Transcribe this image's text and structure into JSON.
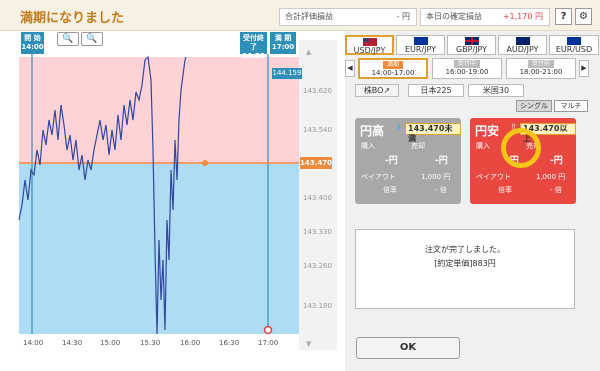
{
  "header": {
    "title": "満期になりました",
    "total_eval_label": "合計評価損益",
    "total_eval_value": "- 円",
    "today_pl_label": "本日の確定損益",
    "today_pl_value": "+1,170 円",
    "help_label": "?",
    "settings_icon": "gear-icon"
  },
  "chart": {
    "start_label_top": "開 始",
    "start_label_bottom": "14:00",
    "cutoff_label_top": "受付終了",
    "cutoff_label_bottom": "16:58",
    "expiry_label_top": "満 期",
    "expiry_label_bottom": "17:00",
    "current_price": "144.159",
    "strike_price": "143.470",
    "y_ticks": [
      "143.620",
      "143.540",
      "143.400",
      "143.330",
      "143.260",
      "143.180"
    ],
    "x_ticks": [
      "14:00",
      "14:30",
      "15:00",
      "15:30",
      "16:00",
      "16:30",
      "17:00"
    ],
    "zoom_out_icon": "zoom-out-icon",
    "zoom_in_icon": "zoom-in-icon",
    "scroll_up_icon": "scroll-up-icon",
    "scroll_down_icon": "scroll-down-icon"
  },
  "currencies": [
    {
      "label": "USD/JPY",
      "selected": true
    },
    {
      "label": "EUR/JPY",
      "selected": false
    },
    {
      "label": "GBP/JPY",
      "selected": false
    },
    {
      "label": "AUD/JPY",
      "selected": false
    },
    {
      "label": "EUR/USD",
      "selected": false
    }
  ],
  "sessions": [
    {
      "badge": "満期",
      "time": "14:00-17:00",
      "selected": true
    },
    {
      "badge": "受付中",
      "time": "16:00-19:00",
      "selected": false
    },
    {
      "badge": "受付前",
      "time": "18:00-21:00",
      "selected": false
    }
  ],
  "tabs": [
    "株BO↗",
    "日本225",
    "米国30"
  ],
  "modes": [
    "シングル",
    "マルチ"
  ],
  "high_option": {
    "title": "円高",
    "rate": "143.470未満",
    "buy_label": "購入",
    "sell_label": "売却",
    "buy_value": "-円",
    "sell_value": "-円",
    "payout_label": "ペイアウト",
    "payout_value": "1,000 円",
    "multiplier_label": "倍率",
    "multiplier_value": "- 倍"
  },
  "low_option": {
    "title": "円安",
    "rate": "143.470以上",
    "buy_label": "購入",
    "sell_label": "売却",
    "buy_value": "-円",
    "sell_value": "-円",
    "payout_label": "ペイアウト",
    "payout_value": "1,000 円",
    "multiplier_label": "倍率",
    "multiplier_value": "- 倍"
  },
  "message": {
    "line1": "注文が完了しました。",
    "line2": "[約定単価]883円"
  },
  "ok_label": "OK",
  "colors": {
    "accent": "#c07a1f",
    "profit": "#e04040",
    "buy_high_bg": "#a8a8a8",
    "buy_low_bg": "#e8483f",
    "chart_line": "#3048a0",
    "strike_line": "#f08a3c",
    "chart_teal": "#2e8fb8"
  }
}
